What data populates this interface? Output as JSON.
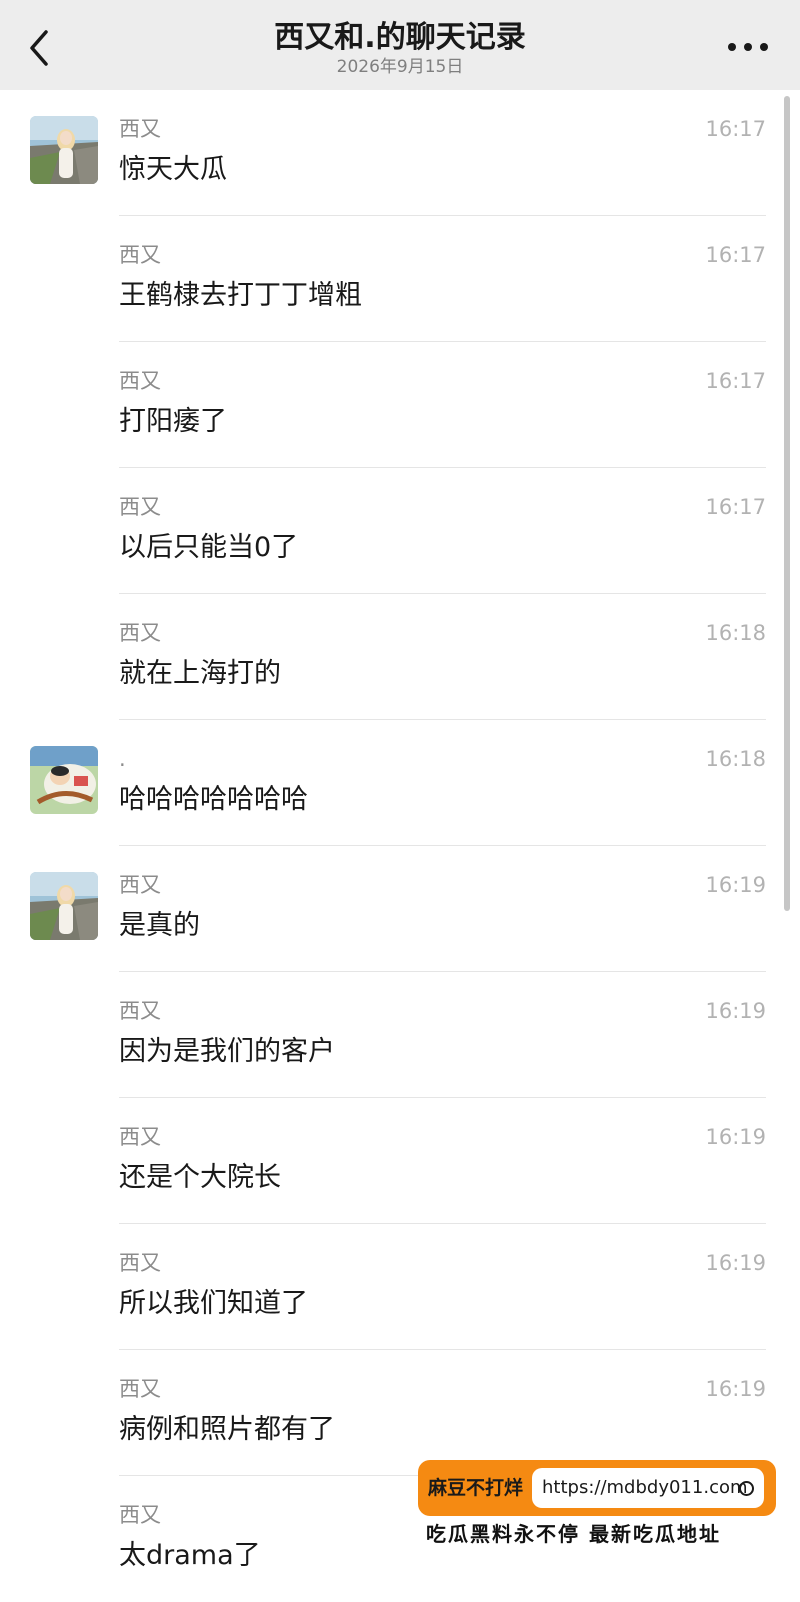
{
  "header": {
    "title": "西又和.的聊天记录",
    "date": "2026年9月15日",
    "back_icon": "chevron-left-icon",
    "more_icon": "more-dots-icon"
  },
  "messages": [
    {
      "sender": "西又",
      "time": "16:17",
      "text": "惊天大瓜",
      "avatar": "avatar-xiyou"
    },
    {
      "sender": "西又",
      "time": "16:17",
      "text": "王鹤棣去打丁丁增粗",
      "avatar": ""
    },
    {
      "sender": "西又",
      "time": "16:17",
      "text": "打阳痿了",
      "avatar": ""
    },
    {
      "sender": "西又",
      "time": "16:17",
      "text": "以后只能当0了",
      "avatar": ""
    },
    {
      "sender": "西又",
      "time": "16:18",
      "text": "就在上海打的",
      "avatar": ""
    },
    {
      "sender": ".",
      "time": "16:18",
      "text": "哈哈哈哈哈哈哈",
      "avatar": "avatar-dot"
    },
    {
      "sender": "西又",
      "time": "16:19",
      "text": "是真的",
      "avatar": "avatar-xiyou"
    },
    {
      "sender": "西又",
      "time": "16:19",
      "text": "因为是我们的客户",
      "avatar": ""
    },
    {
      "sender": "西又",
      "time": "16:19",
      "text": "还是个大院长",
      "avatar": ""
    },
    {
      "sender": "西又",
      "time": "16:19",
      "text": "所以我们知道了",
      "avatar": ""
    },
    {
      "sender": "西又",
      "time": "16:19",
      "text": "病例和照片都有了",
      "avatar": ""
    },
    {
      "sender": "西又",
      "time": "",
      "text": "太drama了",
      "avatar": ""
    }
  ],
  "watermark": {
    "brand": "麻豆不打烊",
    "url": "https://mdbdy011.com",
    "slogan": "吃瓜黑料永不停  最新吃瓜地址"
  },
  "colors": {
    "header_bg": "#ededed",
    "badge_orange": "#f58a12",
    "time_gray": "#b2b2b2",
    "sender_gray": "#8c8c8c"
  }
}
